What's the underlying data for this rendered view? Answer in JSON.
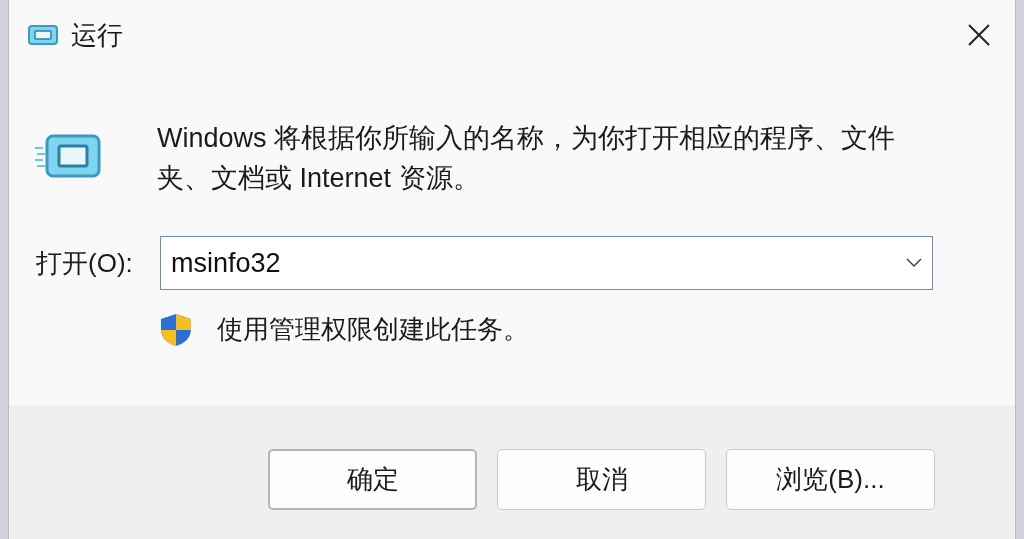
{
  "window": {
    "title": "运行"
  },
  "description": "Windows 将根据你所输入的名称，为你打开相应的程序、文件夹、文档或 Internet 资源。",
  "open": {
    "label": "打开(O):",
    "value": "msinfo32"
  },
  "admin_note": "使用管理权限创建此任务。",
  "buttons": [
    {
      "label": "确定",
      "default": true
    },
    {
      "label": "取消",
      "default": false
    },
    {
      "label": "浏览(B)...",
      "default": false
    }
  ]
}
